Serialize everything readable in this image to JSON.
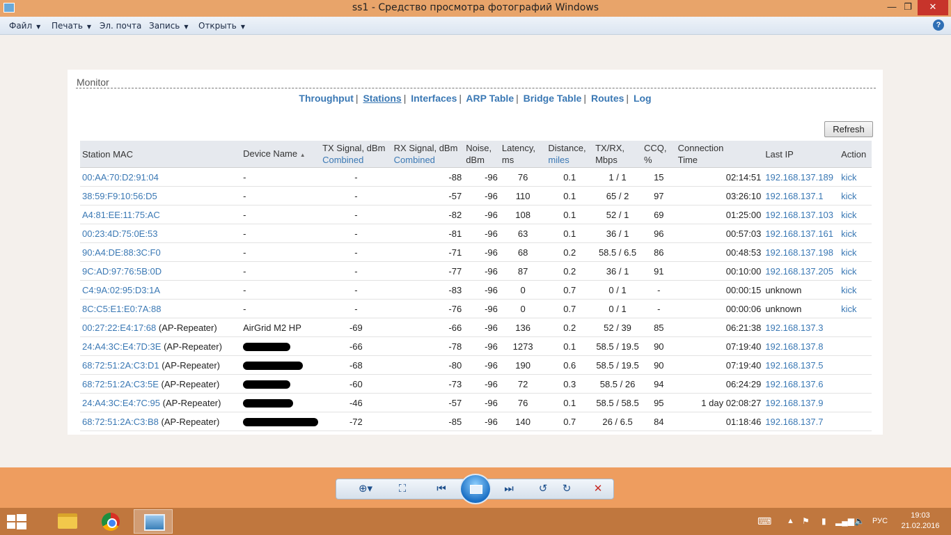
{
  "window": {
    "title": "ss1 - Средство просмотра фотографий Windows",
    "controls": {
      "minimize": "—",
      "maximize": "❐",
      "close": "✕"
    }
  },
  "menubar": {
    "items": [
      {
        "label": "Файл",
        "dropdown": true
      },
      {
        "label": "Печать",
        "dropdown": true
      },
      {
        "label": "Эл. почта",
        "dropdown": false
      },
      {
        "label": "Запись",
        "dropdown": true
      },
      {
        "label": "Открыть",
        "dropdown": true
      }
    ],
    "help": "?"
  },
  "monitor": {
    "title": "Monitor",
    "nav": [
      "Throughput",
      "Stations",
      "Interfaces",
      "ARP Table",
      "Bridge Table",
      "Routes",
      "Log"
    ],
    "active_nav": "Stations",
    "refresh_label": "Refresh",
    "columns": [
      {
        "label": "Station MAC",
        "sub": ""
      },
      {
        "label": "Device Name",
        "sub": "",
        "sorted": "▲"
      },
      {
        "label": "TX Signal, dBm",
        "sub": "Combined"
      },
      {
        "label": "RX Signal, dBm",
        "sub": "Combined"
      },
      {
        "label": "Noise,",
        "sub": "dBm"
      },
      {
        "label": "Latency,",
        "sub": "ms"
      },
      {
        "label": "Distance,",
        "sub": "miles"
      },
      {
        "label": "TX/RX,",
        "sub": "Mbps"
      },
      {
        "label": "CCQ,",
        "sub": "%"
      },
      {
        "label": "Connection",
        "sub": "Time"
      },
      {
        "label": "Last IP",
        "sub": ""
      },
      {
        "label": "Action",
        "sub": ""
      }
    ],
    "rows": [
      {
        "mac": "00:AA:70:D2:91:04",
        "role": "",
        "device": "-",
        "tx": "-",
        "rx": "-88",
        "noise": "-96",
        "latency": "76",
        "distance": "0.1",
        "txrx": "1 / 1",
        "ccq": "15",
        "time": "02:14:51",
        "ip": "192.168.137.189",
        "action": "kick"
      },
      {
        "mac": "38:59:F9:10:56:D5",
        "role": "",
        "device": "-",
        "tx": "-",
        "rx": "-57",
        "noise": "-96",
        "latency": "110",
        "distance": "0.1",
        "txrx": "65 / 2",
        "ccq": "97",
        "time": "03:26:10",
        "ip": "192.168.137.1",
        "action": "kick"
      },
      {
        "mac": "A4:81:EE:11:75:AC",
        "role": "",
        "device": "-",
        "tx": "-",
        "rx": "-82",
        "noise": "-96",
        "latency": "108",
        "distance": "0.1",
        "txrx": "52 / 1",
        "ccq": "69",
        "time": "01:25:00",
        "ip": "192.168.137.103",
        "action": "kick"
      },
      {
        "mac": "00:23:4D:75:0E:53",
        "role": "",
        "device": "-",
        "tx": "-",
        "rx": "-81",
        "noise": "-96",
        "latency": "63",
        "distance": "0.1",
        "txrx": "36 / 1",
        "ccq": "96",
        "time": "00:57:03",
        "ip": "192.168.137.161",
        "action": "kick"
      },
      {
        "mac": "90:A4:DE:88:3C:F0",
        "role": "",
        "device": "-",
        "tx": "-",
        "rx": "-71",
        "noise": "-96",
        "latency": "68",
        "distance": "0.2",
        "txrx": "58.5 / 6.5",
        "ccq": "86",
        "time": "00:48:53",
        "ip": "192.168.137.198",
        "action": "kick"
      },
      {
        "mac": "9C:AD:97:76:5B:0D",
        "role": "",
        "device": "-",
        "tx": "-",
        "rx": "-77",
        "noise": "-96",
        "latency": "87",
        "distance": "0.2",
        "txrx": "36 / 1",
        "ccq": "91",
        "time": "00:10:00",
        "ip": "192.168.137.205",
        "action": "kick"
      },
      {
        "mac": "C4:9A:02:95:D3:1A",
        "role": "",
        "device": "-",
        "tx": "-",
        "rx": "-83",
        "noise": "-96",
        "latency": "0",
        "distance": "0.7",
        "txrx": "0 / 1",
        "ccq": "-",
        "time": "00:00:15",
        "ip": "unknown",
        "action": "kick"
      },
      {
        "mac": "8C:C5:E1:E0:7A:88",
        "role": "",
        "device": "-",
        "tx": "-",
        "rx": "-76",
        "noise": "-96",
        "latency": "0",
        "distance": "0.7",
        "txrx": "0 / 1",
        "ccq": "-",
        "time": "00:00:06",
        "ip": "unknown",
        "action": "kick"
      },
      {
        "mac": "00:27:22:E4:17:68",
        "role": "(AP-Repeater)",
        "device": "AirGrid M2 HP",
        "tx": "-69",
        "rx": "-66",
        "noise": "-96",
        "latency": "136",
        "distance": "0.2",
        "txrx": "52 / 39",
        "ccq": "85",
        "time": "06:21:38",
        "ip": "192.168.137.3",
        "action": ""
      },
      {
        "mac": "24:A4:3C:E4:7D:3E",
        "role": "(AP-Repeater)",
        "device": "",
        "tx": "-66",
        "rx": "-78",
        "noise": "-96",
        "latency": "1273",
        "distance": "0.1",
        "txrx": "58.5 / 19.5",
        "ccq": "90",
        "time": "07:19:40",
        "ip": "192.168.137.8",
        "action": ""
      },
      {
        "mac": "68:72:51:2A:C3:D1",
        "role": "(AP-Repeater)",
        "device": "",
        "tx": "-68",
        "rx": "-80",
        "noise": "-96",
        "latency": "190",
        "distance": "0.6",
        "txrx": "58.5 / 19.5",
        "ccq": "90",
        "time": "07:19:40",
        "ip": "192.168.137.5",
        "action": ""
      },
      {
        "mac": "68:72:51:2A:C3:5E",
        "role": "(AP-Repeater)",
        "device": "",
        "tx": "-60",
        "rx": "-73",
        "noise": "-96",
        "latency": "72",
        "distance": "0.3",
        "txrx": "58.5 / 26",
        "ccq": "94",
        "time": "06:24:29",
        "ip": "192.168.137.6",
        "action": ""
      },
      {
        "mac": "24:A4:3C:E4:7C:95",
        "role": "(AP-Repeater)",
        "device": "",
        "tx": "-46",
        "rx": "-57",
        "noise": "-96",
        "latency": "76",
        "distance": "0.1",
        "txrx": "58.5 / 58.5",
        "ccq": "95",
        "time": "1 day 02:08:27",
        "ip": "192.168.137.9",
        "action": ""
      },
      {
        "mac": "68:72:51:2A:C3:B8",
        "role": "(AP-Repeater)",
        "device": "",
        "tx": "-72",
        "rx": "-85",
        "noise": "-96",
        "latency": "140",
        "distance": "0.7",
        "txrx": "26 / 6.5",
        "ccq": "84",
        "time": "01:18:46",
        "ip": "192.168.137.7",
        "action": ""
      }
    ]
  },
  "viewer_toolbar": {
    "zoom_icon": "zoom-icon",
    "fit_icon": "fit-to-window-icon",
    "prev_icon": "previous-icon",
    "slideshow_icon": "slideshow-icon",
    "next_icon": "next-icon",
    "rotate_left_icon": "rotate-ccw-icon",
    "rotate_right_icon": "rotate-cw-icon",
    "delete_icon": "delete-icon"
  },
  "taskbar": {
    "apps": [
      "file-explorer-icon",
      "chrome-icon",
      "photo-viewer-icon"
    ],
    "language": "РУС",
    "time": "19:03",
    "date": "21.02.2016"
  },
  "colors": {
    "titlebar": "#e8a46a",
    "link": "#3a78b4",
    "taskbar": "#c0773e"
  }
}
